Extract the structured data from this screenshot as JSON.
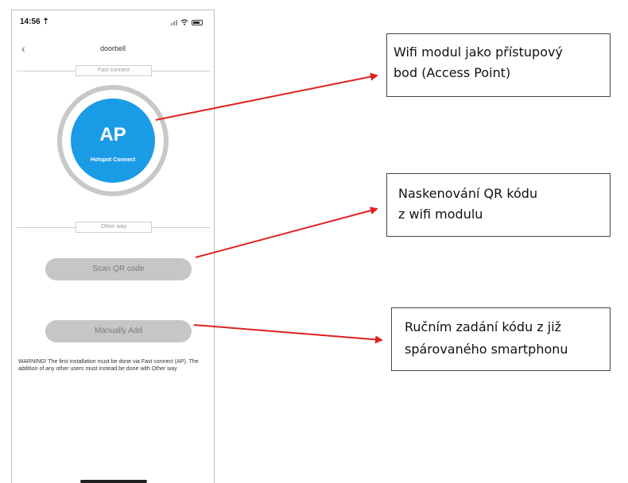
{
  "status_bar": {
    "time": "14:56 ⇡"
  },
  "nav": {
    "title": "doorbell"
  },
  "sections": {
    "fast_connect": "Fast connect",
    "other_way": "Other way"
  },
  "ap_button": {
    "title": "AP",
    "subtitle": "Hotspot Connect",
    "color": "#1a9be6"
  },
  "buttons": {
    "scan_qr": "Scan QR code",
    "manually_add": "Manually Add"
  },
  "warning": "WARNING! The first installation must be done via Fast connect (AP). The addition of any other users must instead be done with Other way",
  "callouts": {
    "ap": [
      "Wifi modul jako přístupový",
      "bod (Access Point)"
    ],
    "qr": [
      "Naskenování QR kódu",
      "z wifi modulu"
    ],
    "manual": [
      "Ručním zadání kódu z již",
      "spárovaného smartphonu"
    ]
  },
  "arrow_color": "#e02020"
}
